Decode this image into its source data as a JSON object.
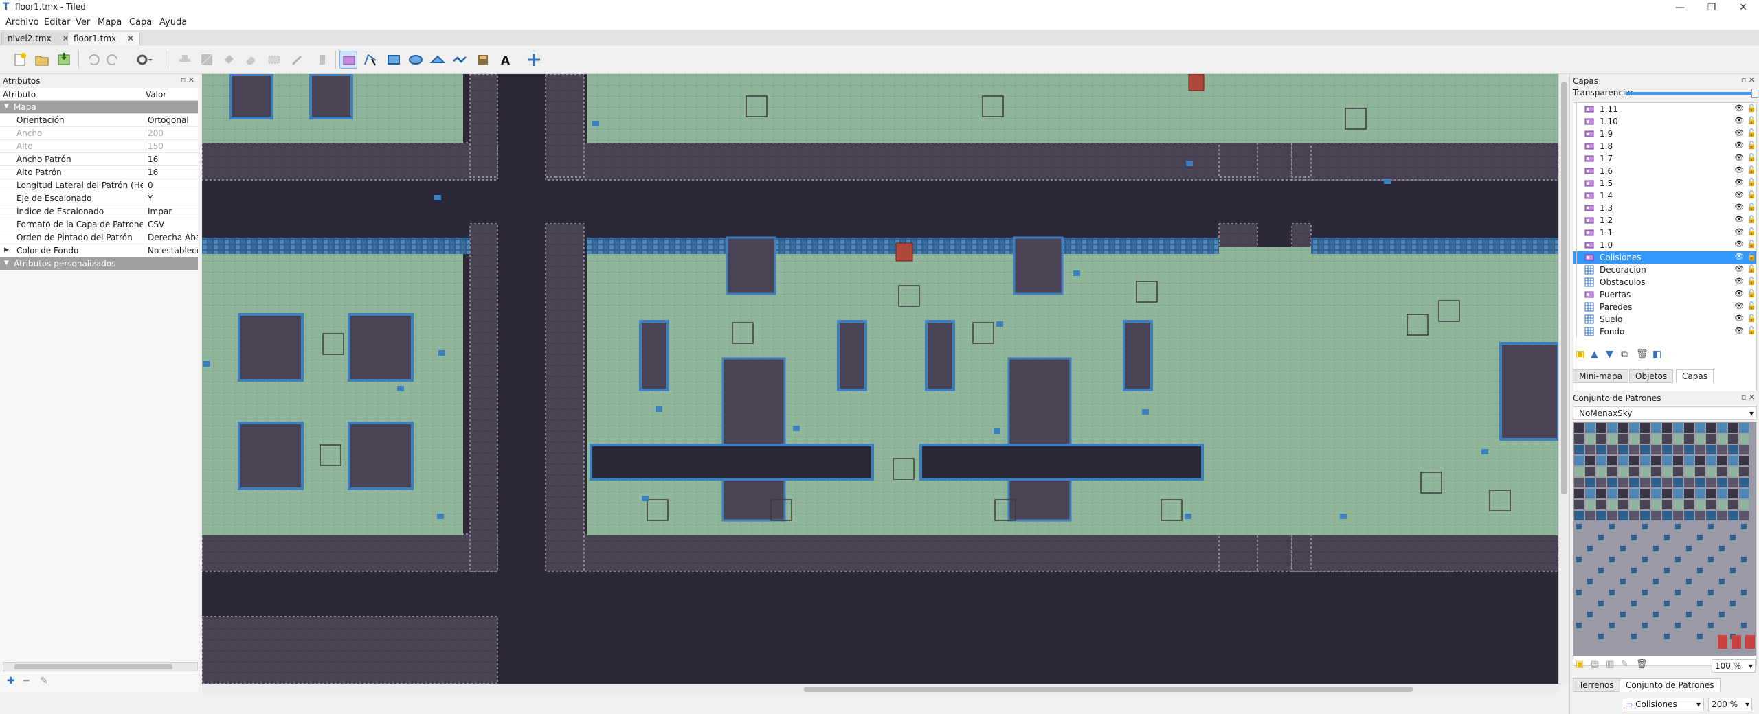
{
  "window": {
    "title": "floor1.tmx - Tiled",
    "controls": [
      "—",
      "❐",
      "✕"
    ]
  },
  "menu": [
    "Archivo",
    "Editar",
    "Ver",
    "Mapa",
    "Capa",
    "Ayuda"
  ],
  "tabs": [
    {
      "label": "nivel2.tmx",
      "close": "✕"
    },
    {
      "label": "floor1.tmx",
      "close": "✕"
    }
  ],
  "toolbar": {
    "icons": [
      "new-map-icon",
      "open-icon",
      "save-icon",
      "undo-icon",
      "redo-icon",
      "commands-icon",
      "stamp-brush-icon",
      "terrain-brush-icon",
      "bucket-fill-icon",
      "eraser-icon",
      "rect-select-icon",
      "magic-wand-icon",
      "select-same-icon",
      "select-objects-icon",
      "edit-polygons-icon",
      "insert-rectangle-icon",
      "insert-ellipse-icon",
      "insert-polygon-icon",
      "insert-polyline-icon",
      "insert-tile-icon",
      "insert-text-icon",
      "random-mode-icon"
    ]
  },
  "attributes": {
    "panel_title": "Atributos",
    "col_key": "Atributo",
    "col_value": "Valor",
    "rows": [
      {
        "key": "Mapa",
        "value": "",
        "type": "group"
      },
      {
        "key": "Orientación",
        "value": "Ortogonal"
      },
      {
        "key": "Ancho",
        "value": "200",
        "type": "disabled"
      },
      {
        "key": "Alto",
        "value": "150",
        "type": "disabled"
      },
      {
        "key": "Ancho Patrón",
        "value": "16"
      },
      {
        "key": "Alto Patrón",
        "value": "16"
      },
      {
        "key": "Longitud Lateral del Patrón (Hex)",
        "value": "0"
      },
      {
        "key": "Eje de Escalonado",
        "value": "Y"
      },
      {
        "key": "Índice de Escalonado",
        "value": "Impar"
      },
      {
        "key": "Formato de la Capa de Patrones",
        "value": "CSV"
      },
      {
        "key": "Orden de Pintado del Patrón",
        "value": "Derecha Abajo"
      },
      {
        "key": "Color de Fondo",
        "value": "No establecer",
        "type": "expand"
      },
      {
        "key": "Atributos personalizados",
        "value": "",
        "type": "group"
      }
    ]
  },
  "layers": {
    "panel_title": "Capas",
    "opacity_label": "Transparencia:",
    "items": [
      {
        "name": "1.11",
        "kind": "object",
        "selected": false
      },
      {
        "name": "1.10",
        "kind": "object",
        "selected": false
      },
      {
        "name": "1.9",
        "kind": "object",
        "selected": false
      },
      {
        "name": "1.8",
        "kind": "object",
        "selected": false
      },
      {
        "name": "1.7",
        "kind": "object",
        "selected": false
      },
      {
        "name": "1.6",
        "kind": "object",
        "selected": false
      },
      {
        "name": "1.5",
        "kind": "object",
        "selected": false
      },
      {
        "name": "1.4",
        "kind": "object",
        "selected": false
      },
      {
        "name": "1.3",
        "kind": "object",
        "selected": false
      },
      {
        "name": "1.2",
        "kind": "object",
        "selected": false
      },
      {
        "name": "1.1",
        "kind": "object",
        "selected": false
      },
      {
        "name": "1.0",
        "kind": "object",
        "selected": false
      },
      {
        "name": "Colisiones",
        "kind": "object",
        "selected": true
      },
      {
        "name": "Decoracion",
        "kind": "tile",
        "selected": false
      },
      {
        "name": "Obstaculos",
        "kind": "tile",
        "selected": false
      },
      {
        "name": "Puertas",
        "kind": "object",
        "selected": false
      },
      {
        "name": "Paredes",
        "kind": "tile",
        "selected": false
      },
      {
        "name": "Suelo",
        "kind": "tile",
        "selected": false
      },
      {
        "name": "Fondo",
        "kind": "tile",
        "selected": false
      }
    ],
    "tabs": [
      "Mini-mapa",
      "Objetos",
      "Capas"
    ]
  },
  "tilesets": {
    "panel_title": "Conjunto de Patrones",
    "selected": "NoMenaxSky",
    "zoom": "100 %",
    "bottom_tabs": [
      "Terrenos",
      "Conjunto de Patrones"
    ]
  },
  "status": {
    "layer": "Colisiones",
    "zoom": "200 %"
  },
  "colors": {
    "floor": "#8fb59a",
    "wall": "#4a4356",
    "void": "#2d2838",
    "accent": "#3d7fbf",
    "selection": "#3399ff"
  }
}
